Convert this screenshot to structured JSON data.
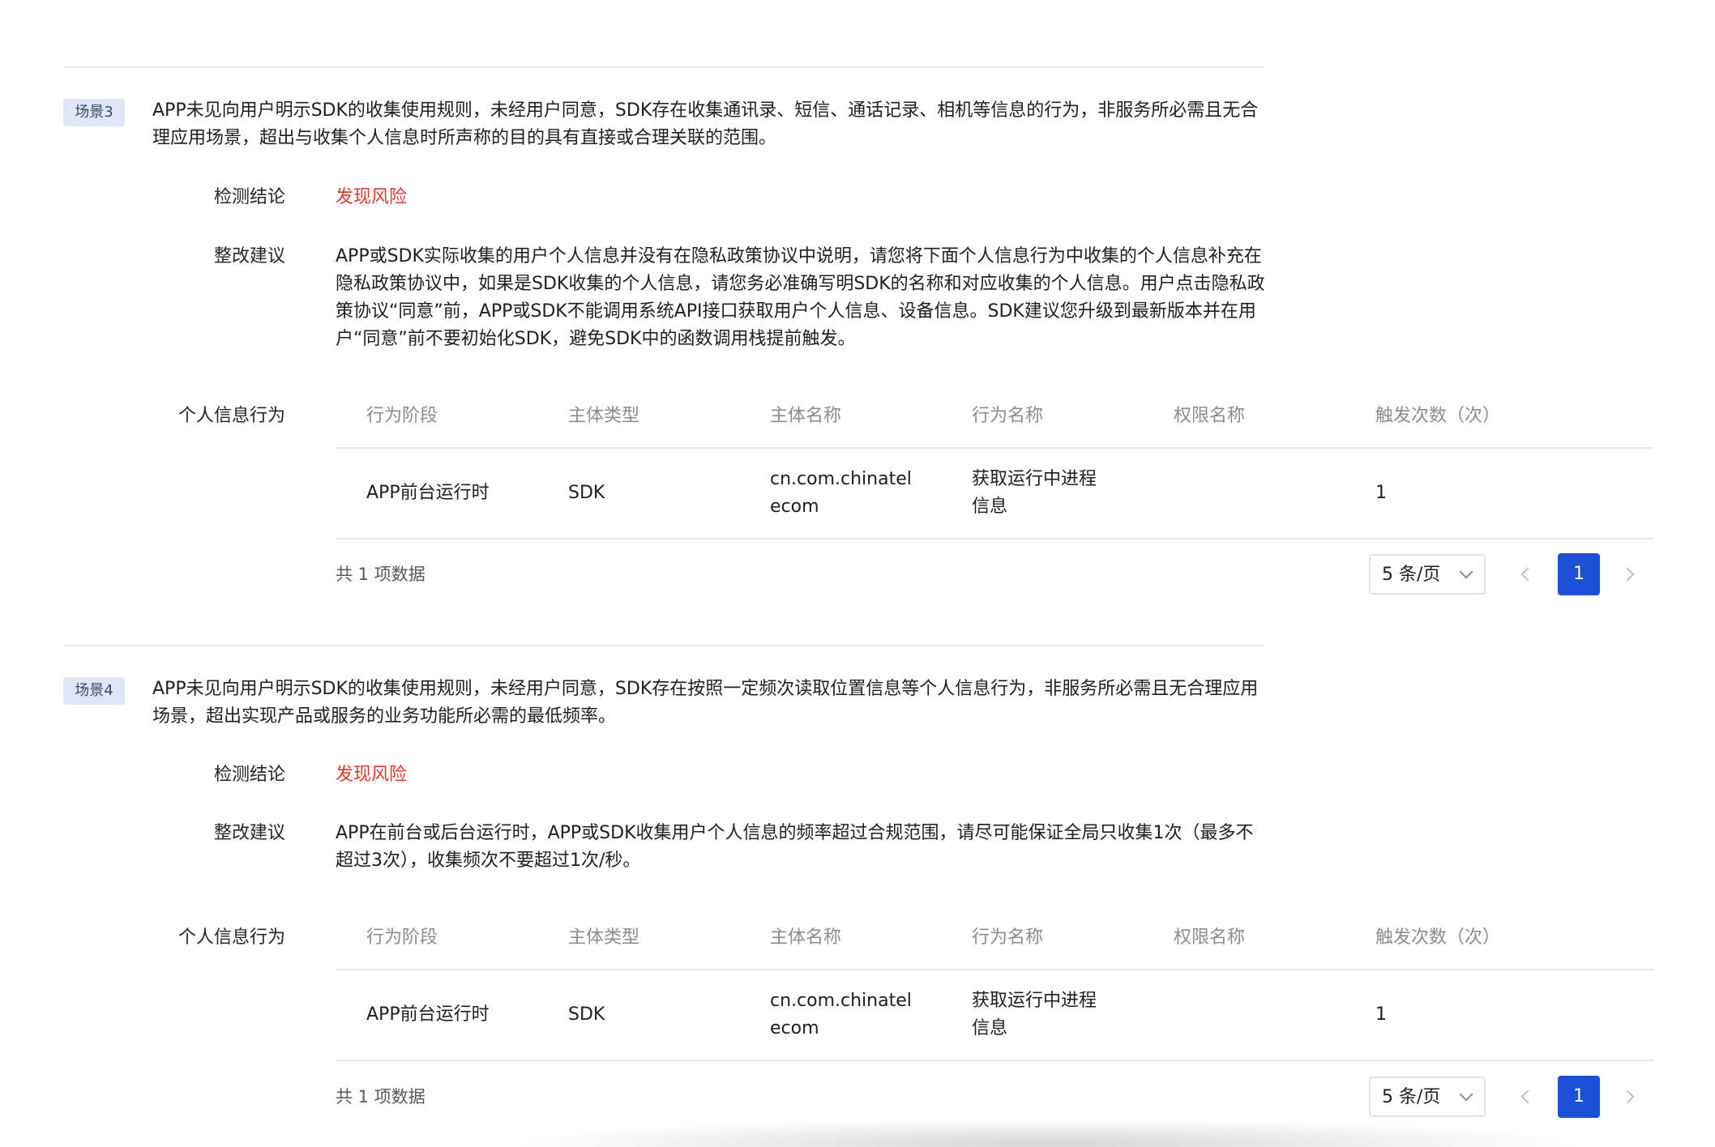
{
  "scenarios": [
    {
      "tag": "场景3",
      "description": "APP未见向用户明示SDK的收集使用规则，未经用户同意，SDK存在收集通讯录、短信、通话记录、相机等信息的行为，非服务所必需且无合理应用场景，超出与收集个人信息时所声称的目的具有直接或合理关联的范围。",
      "conclusion_label": "检测结论",
      "conclusion_value": "发现风险",
      "suggestion_label": "整改建议",
      "suggestion_value": "APP或SDK实际收集的用户个人信息并没有在隐私政策协议中说明，请您将下面个人信息行为中收集的个人信息补充在隐私政策协议中，如果是SDK收集的个人信息，请您务必准确写明SDK的名称和对应收集的个人信息。用户点击隐私政策协议“同意”前，APP或SDK不能调用系统API接口获取用户个人信息、设备信息。SDK建议您升级到最新版本并在用户“同意”前不要初始化SDK，避免SDK中的函数调用栈提前触发。",
      "behavior_label": "个人信息行为",
      "table": {
        "columns": [
          "行为阶段",
          "主体类型",
          "主体名称",
          "行为名称",
          "权限名称",
          "触发次数（次）"
        ],
        "rows": [
          {
            "stage": "APP前台运行时",
            "subject_type": "SDK",
            "subject_name": "cn.com.chinatelecom",
            "behavior_name": "获取运行中进程信息",
            "permission_name": "",
            "count": "1"
          }
        ]
      },
      "pagination": {
        "total_text": "共 1 项数据",
        "page_size": "5 条/页",
        "current_page": "1"
      }
    },
    {
      "tag": "场景4",
      "description": "APP未见向用户明示SDK的收集使用规则，未经用户同意，SDK存在按照一定频次读取位置信息等个人信息行为，非服务所必需且无合理应用场景，超出实现产品或服务的业务功能所必需的最低频率。",
      "conclusion_label": "检测结论",
      "conclusion_value": "发现风险",
      "suggestion_label": "整改建议",
      "suggestion_value": "APP在前台或后台运行时，APP或SDK收集用户个人信息的频率超过合规范围，请尽可能保证全局只收集1次（最多不超过3次），收集频次不要超过1次/秒。",
      "behavior_label": "个人信息行为",
      "table": {
        "columns": [
          "行为阶段",
          "主体类型",
          "主体名称",
          "行为名称",
          "权限名称",
          "触发次数（次）"
        ],
        "rows": [
          {
            "stage": "APP前台运行时",
            "subject_type": "SDK",
            "subject_name": "cn.com.chinatelecom",
            "behavior_name": "获取运行中进程信息",
            "permission_name": "",
            "count": "1"
          }
        ]
      },
      "pagination": {
        "total_text": "共 1 项数据",
        "page_size": "5 条/页",
        "current_page": "1"
      }
    }
  ],
  "colors": {
    "risk": "#e6372e",
    "tag_bg": "#dfe7f6",
    "primary": "#1b50d8"
  },
  "icons": {
    "page_size_dropdown": "chevron-down-icon",
    "prev_page": "chevron-left-icon",
    "next_page": "chevron-right-icon"
  }
}
